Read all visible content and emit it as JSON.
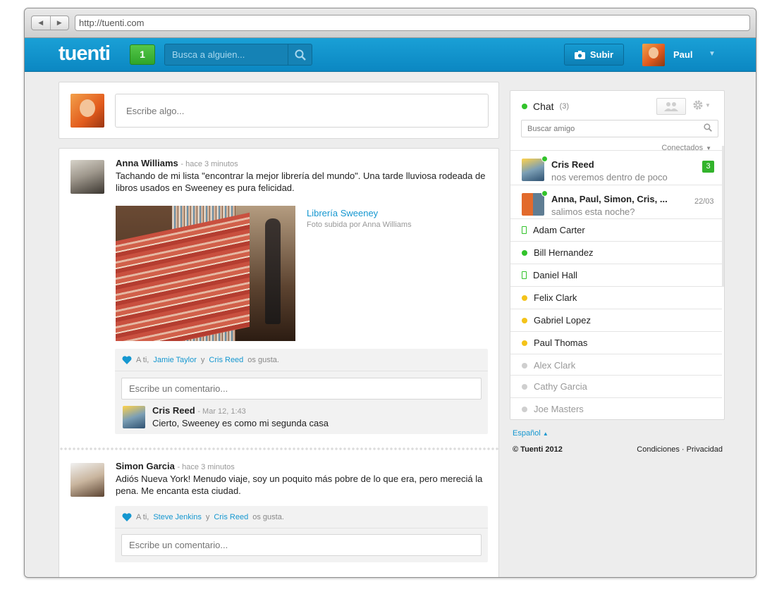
{
  "browser": {
    "url": "http://tuenti.com"
  },
  "header": {
    "logo": "tuenti",
    "notifications": "1",
    "search_placeholder": "Busca a alguien...",
    "upload_label": "Subir",
    "username": "Paul"
  },
  "composer": {
    "placeholder": "Escribe algo..."
  },
  "posts": [
    {
      "author": "Anna Williams",
      "time": "- hace 3 minutos",
      "text": "Tachando de mi lista \"encontrar la mejor librería del mundo\". Una tarde lluviosa rodeada de libros usados en Sweeney es pura felicidad.",
      "photo_title": "Librería Sweeney",
      "photo_subtitle": "Foto subida por Anna Williams",
      "likes_prefix": "A ti,",
      "likes_user1": "Jamie Taylor",
      "likes_and": "y",
      "likes_user2": "Cris Reed",
      "likes_suffix": "os gusta.",
      "comment_placeholder": "Escribe un comentario...",
      "reply": {
        "author": "Cris Reed",
        "time": "- Mar 12, 1:43",
        "text": "Cierto, Sweeney es como mi segunda casa"
      }
    },
    {
      "author": "Simon Garcia",
      "time": "- hace 3 minutos",
      "text": "Adiós Nueva York! Menudo viaje, soy un poquito más pobre de lo que era, pero mereciá la pena. Me encanta esta ciudad.",
      "likes_prefix": "A ti,",
      "likes_user1": "Steve Jenkins",
      "likes_and": "y",
      "likes_user2": "Cris Reed",
      "likes_suffix": "os gusta.",
      "comment_placeholder": "Escribe un comentario..."
    }
  ],
  "chat": {
    "title": "Chat",
    "count": "(3)",
    "search_placeholder": "Buscar amigo",
    "filter_label": "Conectados",
    "conversations": [
      {
        "name": "Cris Reed",
        "message": "nos veremos dentro de poco",
        "badge": "3"
      },
      {
        "name": "Anna, Paul, Simon, Cris, ...",
        "message": "salimos esta noche?",
        "date": "22/03"
      }
    ],
    "friends": [
      {
        "name": "Adam Carter",
        "status": "mobile"
      },
      {
        "name": "Bill Hernandez",
        "status": "online"
      },
      {
        "name": "Daniel Hall",
        "status": "mobile"
      },
      {
        "name": "Felix Clark",
        "status": "away"
      },
      {
        "name": "Gabriel Lopez",
        "status": "away"
      },
      {
        "name": "Paul Thomas",
        "status": "away"
      },
      {
        "name": "Alex Clark",
        "status": "offline"
      },
      {
        "name": "Cathy Garcia",
        "status": "offline"
      },
      {
        "name": "Joe Masters",
        "status": "offline"
      }
    ]
  },
  "footer": {
    "language": "Español",
    "copyright": "© Tuenti 2012",
    "conditions": "Condiciones",
    "separator": "·",
    "privacy": "Privacidad"
  },
  "colors": {
    "brand_blue": "#0b87c2",
    "link_blue": "#1597d0",
    "online_green": "#32c32b",
    "away_yellow": "#f4c31a"
  }
}
